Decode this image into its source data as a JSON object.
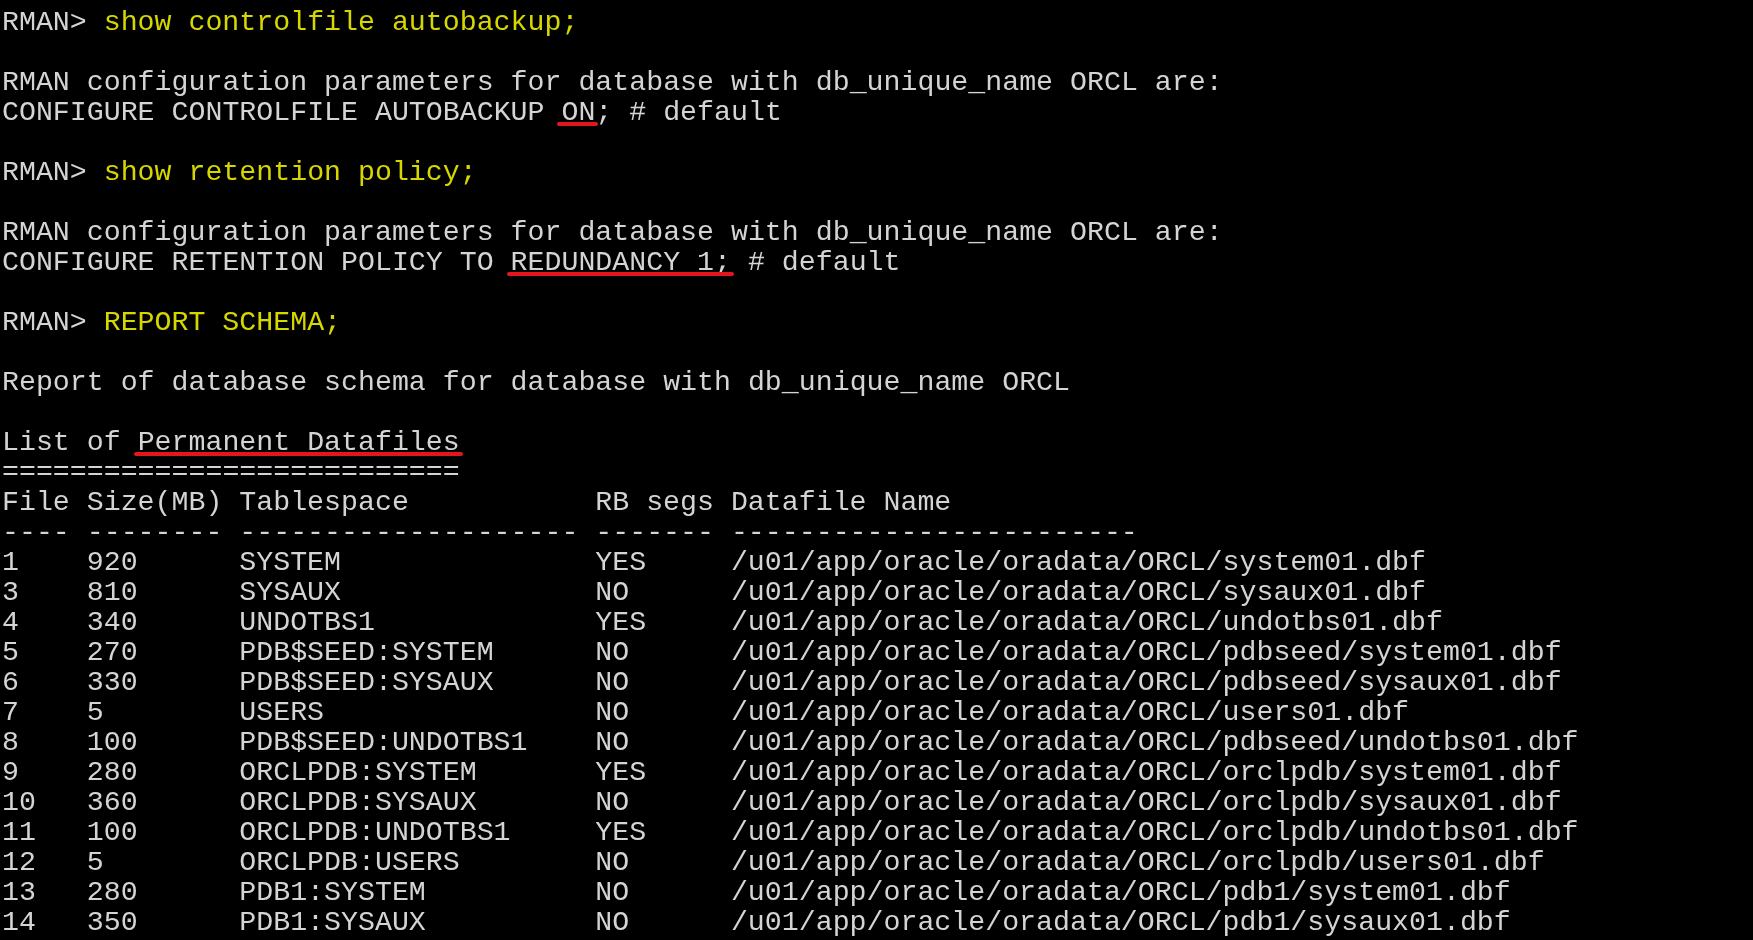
{
  "terminal": {
    "session": [
      {
        "prompt": "RMAN>",
        "command": "show controlfile autobackup;",
        "output": [
          {
            "kind": "text",
            "lines": [
              {
                "segments": [
                  {
                    "text": "RMAN configuration parameters for database with db_unique_name ORCL are:",
                    "marked": false
                  }
                ]
              },
              {
                "segments": [
                  {
                    "text": "CONFIGURE CONTROLFILE AUTOBACKUP ",
                    "marked": false
                  },
                  {
                    "text": "ON",
                    "marked": true
                  },
                  {
                    "text": "; # default",
                    "marked": false
                  }
                ]
              }
            ]
          }
        ]
      },
      {
        "prompt": "RMAN>",
        "command": "show retention policy;",
        "output": [
          {
            "kind": "text",
            "lines": [
              {
                "segments": [
                  {
                    "text": "RMAN configuration parameters for database with db_unique_name ORCL are:",
                    "marked": false
                  }
                ]
              },
              {
                "segments": [
                  {
                    "text": "CONFIGURE RETENTION POLICY TO ",
                    "marked": false
                  },
                  {
                    "text": "REDUNDANCY 1;",
                    "marked": true
                  },
                  {
                    "text": " # default",
                    "marked": false
                  }
                ]
              }
            ]
          }
        ]
      },
      {
        "prompt": "RMAN>",
        "command": "REPORT SCHEMA;",
        "output": [
          {
            "kind": "text",
            "lines": [
              {
                "segments": [
                  {
                    "text": "Report of database schema for database with db_unique_name ORCL",
                    "marked": false
                  }
                ]
              }
            ]
          },
          {
            "kind": "listing",
            "title": [
              {
                "text": "List of ",
                "marked": false
              },
              {
                "text": "Permanent Datafiles",
                "marked": true
              }
            ],
            "title_rule": "===========================",
            "columns": [
              {
                "label": "File",
                "rule": "----"
              },
              {
                "label": "Size(MB)",
                "rule": "--------"
              },
              {
                "label": "Tablespace",
                "rule": "--------------------"
              },
              {
                "label": "RB segs",
                "rule": "-------"
              },
              {
                "label": "Datafile Name",
                "rule": "------------------------"
              }
            ],
            "rows": [
              [
                "1",
                "920",
                "SYSTEM",
                "YES",
                "/u01/app/oracle/oradata/ORCL/system01.dbf"
              ],
              [
                "3",
                "810",
                "SYSAUX",
                "NO",
                "/u01/app/oracle/oradata/ORCL/sysaux01.dbf"
              ],
              [
                "4",
                "340",
                "UNDOTBS1",
                "YES",
                "/u01/app/oracle/oradata/ORCL/undotbs01.dbf"
              ],
              [
                "5",
                "270",
                "PDB$SEED:SYSTEM",
                "NO",
                "/u01/app/oracle/oradata/ORCL/pdbseed/system01.dbf"
              ],
              [
                "6",
                "330",
                "PDB$SEED:SYSAUX",
                "NO",
                "/u01/app/oracle/oradata/ORCL/pdbseed/sysaux01.dbf"
              ],
              [
                "7",
                "5",
                "USERS",
                "NO",
                "/u01/app/oracle/oradata/ORCL/users01.dbf"
              ],
              [
                "8",
                "100",
                "PDB$SEED:UNDOTBS1",
                "NO",
                "/u01/app/oracle/oradata/ORCL/pdbseed/undotbs01.dbf"
              ],
              [
                "9",
                "280",
                "ORCLPDB:SYSTEM",
                "YES",
                "/u01/app/oracle/oradata/ORCL/orclpdb/system01.dbf"
              ],
              [
                "10",
                "360",
                "ORCLPDB:SYSAUX",
                "NO",
                "/u01/app/oracle/oradata/ORCL/orclpdb/sysaux01.dbf"
              ],
              [
                "11",
                "100",
                "ORCLPDB:UNDOTBS1",
                "YES",
                "/u01/app/oracle/oradata/ORCL/orclpdb/undotbs01.dbf"
              ],
              [
                "12",
                "5",
                "ORCLPDB:USERS",
                "NO",
                "/u01/app/oracle/oradata/ORCL/orclpdb/users01.dbf"
              ],
              [
                "13",
                "280",
                "PDB1:SYSTEM",
                "NO",
                "/u01/app/oracle/oradata/ORCL/pdb1/system01.dbf"
              ],
              [
                "14",
                "350",
                "PDB1:SYSAUX",
                "NO",
                "/u01/app/oracle/oradata/ORCL/pdb1/sysaux01.dbf"
              ]
            ]
          }
        ]
      }
    ]
  }
}
